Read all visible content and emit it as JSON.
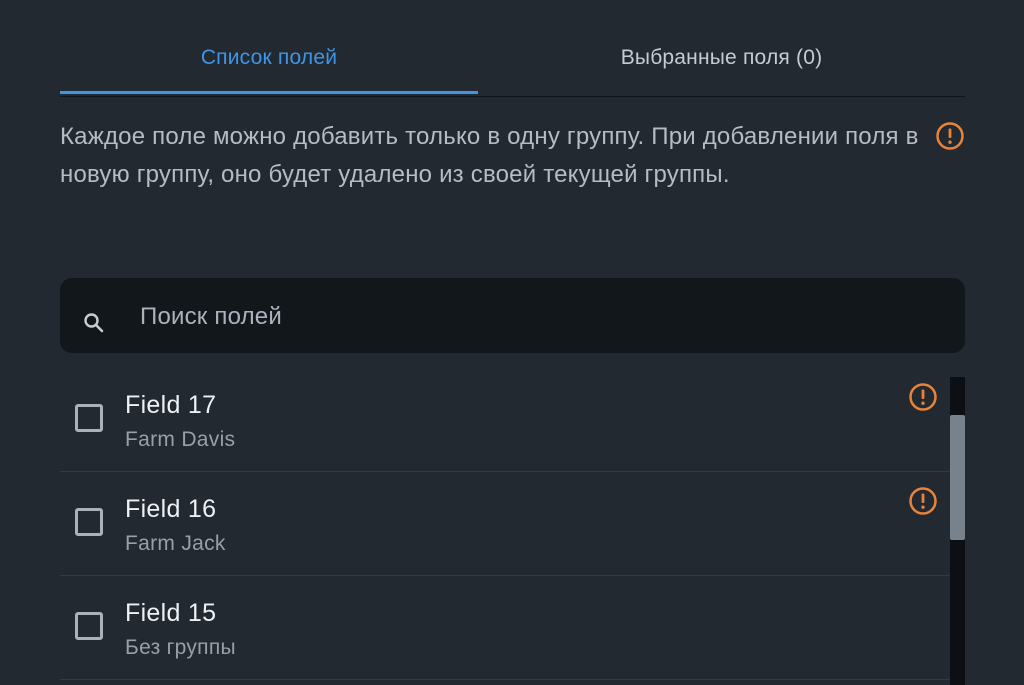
{
  "tabs": [
    {
      "label": "Список полей",
      "active": true
    },
    {
      "label": "Выбранные поля (0)",
      "active": false
    }
  ],
  "notice": {
    "text": "Каждое поле можно добавить только в одну группу. При добавлении поля в новую группу, оно будет удалено из своей текущей группы.",
    "icon": "warning-circle-icon"
  },
  "search": {
    "placeholder": "Поиск полей",
    "value": "",
    "icon": "search-icon"
  },
  "fields": [
    {
      "title": "Field 17",
      "group": "Farm Davis",
      "warning": true,
      "checked": false
    },
    {
      "title": "Field 16",
      "group": "Farm Jack",
      "warning": true,
      "checked": false
    },
    {
      "title": "Field 15",
      "group": "Без группы",
      "warning": false,
      "checked": false
    }
  ],
  "colors": {
    "background": "#222931",
    "accent": "#3f95e6",
    "warning": "#e8843a"
  }
}
